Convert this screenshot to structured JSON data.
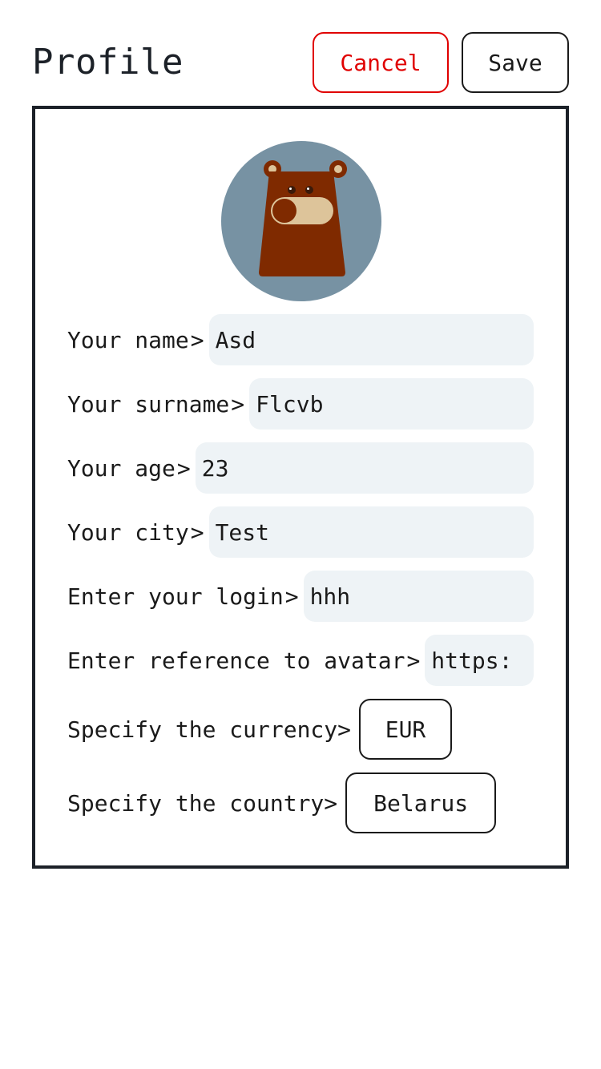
{
  "header": {
    "title": "Profile",
    "cancel_label": "Cancel",
    "save_label": "Save"
  },
  "colors": {
    "accent_red": "#e00000",
    "field_bg": "#eef3f6",
    "avatar_bg": "#7792a3",
    "bear_body": "#7f2a00"
  },
  "form": {
    "name": {
      "label": "Your name",
      "value": "Asd"
    },
    "surname": {
      "label": "Your surname",
      "value": "Flcvb"
    },
    "age": {
      "label": "Your age",
      "value": "23"
    },
    "city": {
      "label": "Your city",
      "value": "Test"
    },
    "login": {
      "label": "Enter your login",
      "value": "hhh"
    },
    "avatar_ref": {
      "label": "Enter reference to avatar",
      "value": "https:"
    },
    "currency": {
      "label": "Specify the currency",
      "value": "EUR"
    },
    "country": {
      "label": "Specify the country",
      "value": "Belarus"
    }
  },
  "chevron": ">"
}
